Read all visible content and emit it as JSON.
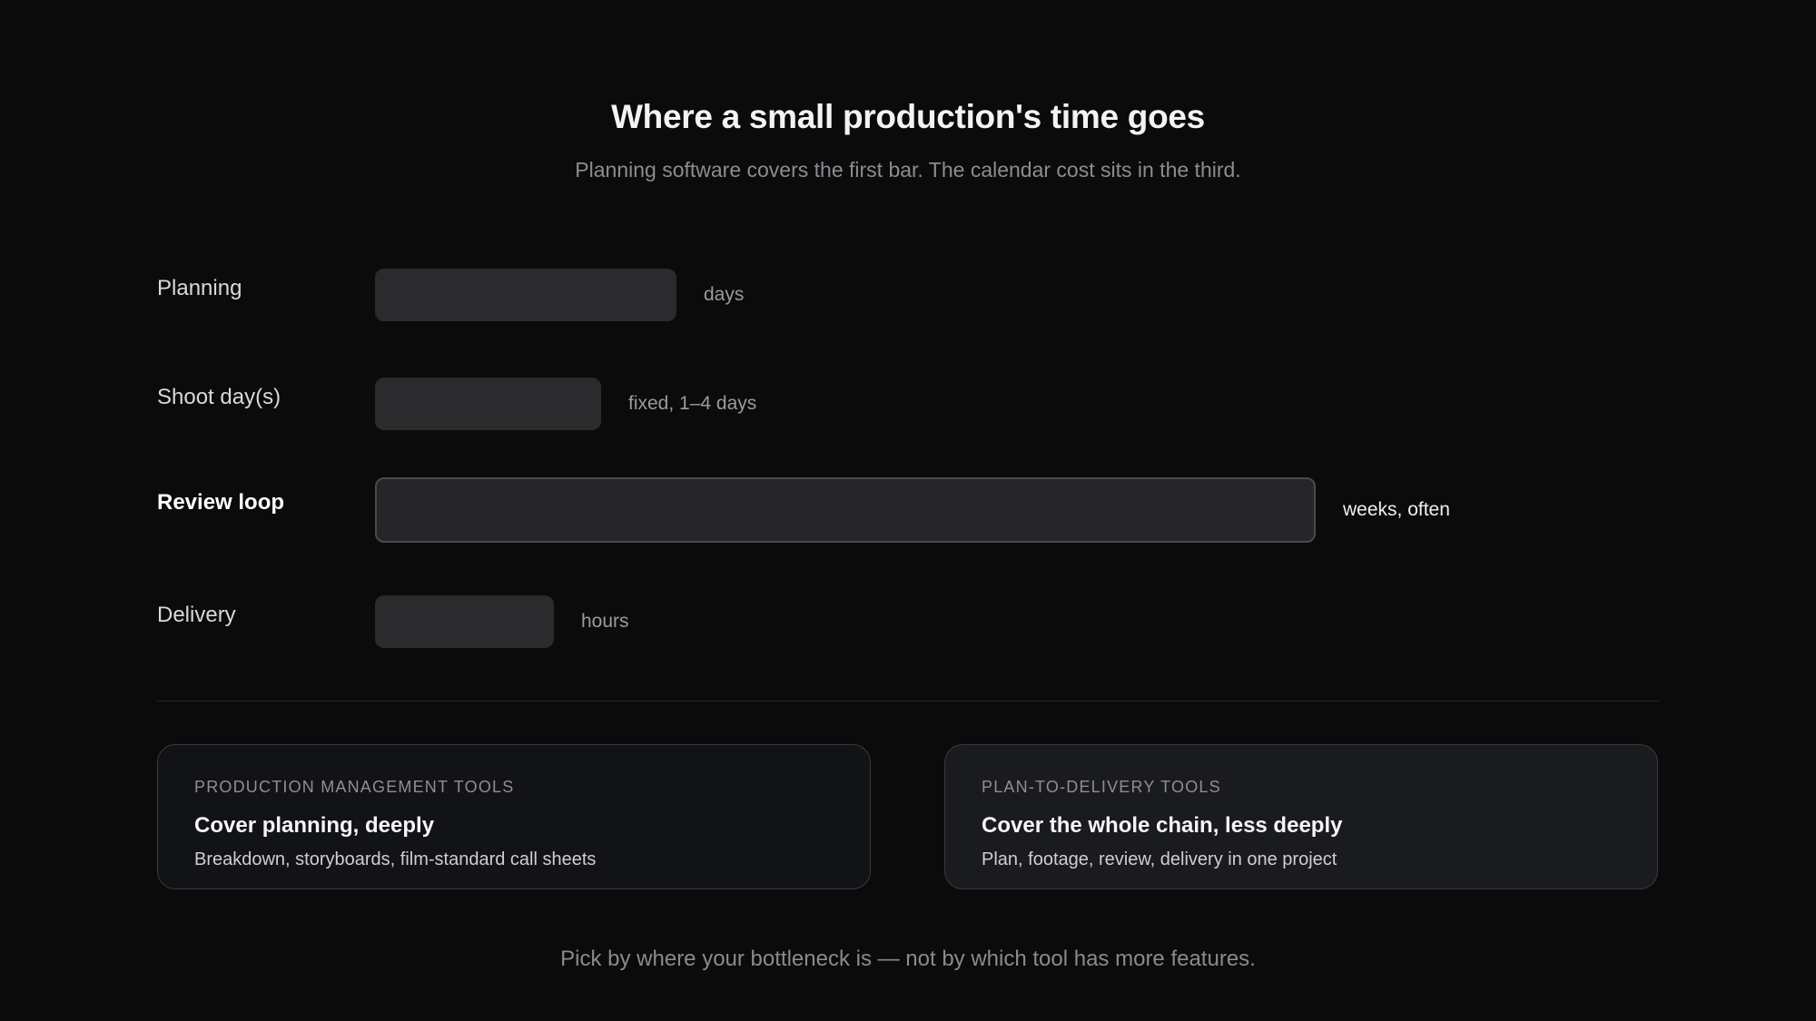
{
  "header": {
    "title": "Where a small production's time goes",
    "subtitle": "Planning software covers the first bar. The calendar cost sits in the third."
  },
  "rows": [
    {
      "label": "Planning",
      "note": "days",
      "relative_length": 0.32,
      "emphasized": false
    },
    {
      "label": "Shoot day(s)",
      "note": "fixed, 1–4 days",
      "relative_length": 0.24,
      "emphasized": false
    },
    {
      "label": "Review loop",
      "note": "weeks, often",
      "relative_length": 1.0,
      "emphasized": true
    },
    {
      "label": "Delivery",
      "note": "hours",
      "relative_length": 0.19,
      "emphasized": false
    }
  ],
  "cards": [
    {
      "eyebrow": "PRODUCTION MANAGEMENT TOOLS",
      "heading": "Cover planning, deeply",
      "body": "Breakdown, storyboards, film-standard call sheets"
    },
    {
      "eyebrow": "PLAN-TO-DELIVERY TOOLS",
      "heading": "Cover the whole chain, less deeply",
      "body": "Plan, footage, review, delivery in one project"
    }
  ],
  "footer": {
    "text": "Pick by where your bottleneck is — not by which tool has more features."
  }
}
